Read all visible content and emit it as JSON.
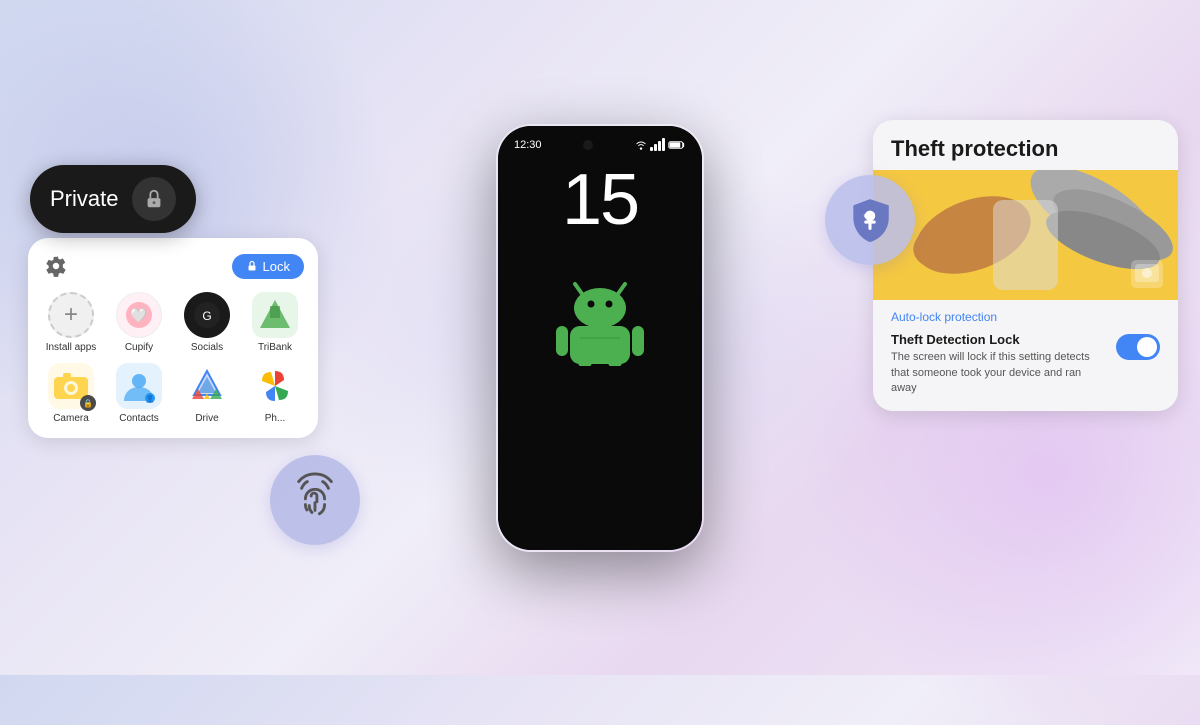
{
  "background": {
    "gradient": "linear-gradient(135deg, #d0d8f0, #e8e4f5, #f0eef8, #e8d8f0)"
  },
  "private_toggle": {
    "label": "Private",
    "icon": "lock-icon"
  },
  "app_grid": {
    "lock_button": "Lock",
    "apps": [
      {
        "name": "Install apps",
        "type": "install"
      },
      {
        "name": "Cupify",
        "type": "cupify"
      },
      {
        "name": "Socials",
        "type": "socials"
      },
      {
        "name": "TriBank",
        "type": "tribank"
      },
      {
        "name": "Camera",
        "type": "camera"
      },
      {
        "name": "Contacts",
        "type": "contacts"
      },
      {
        "name": "Drive",
        "type": "drive"
      },
      {
        "name": "Photos",
        "type": "photos"
      }
    ]
  },
  "phone": {
    "time": "12:30",
    "clock_number": "15"
  },
  "theft_card": {
    "title": "Theft protection",
    "auto_lock_label": "Auto-lock protection",
    "detection_title": "Theft Detection Lock",
    "detection_description": "The screen will lock if this setting detects that someone took your device and ran away",
    "toggle_state": "on"
  },
  "fingerprint_bubble": {
    "icon": "fingerprint-icon"
  },
  "shield_bubble": {
    "icon": "shield-key-icon"
  }
}
